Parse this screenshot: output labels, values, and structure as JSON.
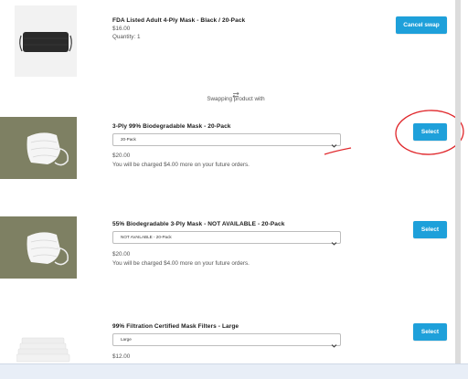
{
  "current_item": {
    "title": "FDA Listed Adult 4-Ply Mask - Black / 20-Pack",
    "price": "$16.00",
    "quantity": "Quantity: 1",
    "cancel_label": "Cancel swap"
  },
  "swap": {
    "icon": "swap-arrows-icon",
    "label": "Swapping product with"
  },
  "options": [
    {
      "title": "3-Ply 99% Biodegradable Mask - 20-Pack",
      "selected": "20-Pack",
      "price": "$20.00",
      "note": "You will be charged $4.00 more on your future orders.",
      "select_label": "Select"
    },
    {
      "title": "55% Biodegradable 3-Ply Mask - NOT AVAILABLE - 20-Pack",
      "selected": "NOT AVAILABLE - 20-Pack",
      "price": "$20.00",
      "note": "You will be charged $4.00 more on your future orders.",
      "select_label": "Select"
    },
    {
      "title": "99% Filtration Certified Mask Filters - Large",
      "selected": "Large",
      "price": "$12.00",
      "select_label": "Select"
    }
  ],
  "colors": {
    "accent": "#1ea0da",
    "annotation": "#e0262a"
  }
}
